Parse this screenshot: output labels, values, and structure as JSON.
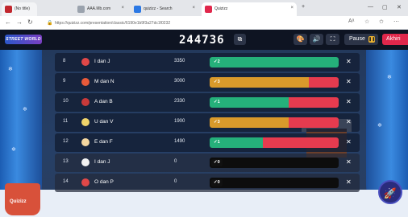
{
  "browser": {
    "tabs": [
      {
        "label": "(No title)",
        "favicon_color": "#c1272d"
      },
      {
        "label": "AAA.Mb.com",
        "favicon_color": "#9aa2ad"
      },
      {
        "label": "quizizz - Search",
        "favicon_color": "#2b78e4"
      },
      {
        "label": "Quizizz",
        "favicon_color": "#e0274b"
      }
    ],
    "url": "https://quizizz.com/presentation/classic/6190e1b9f3a27dc1f0232",
    "back_icon": "back-arrow",
    "forward_icon": "forward-arrow",
    "refresh_icon": "refresh"
  },
  "header": {
    "logo_text": "STREET WORLD",
    "game_code": "244736",
    "pause_label": "Pause",
    "end_label": "Akhiri"
  },
  "leaderboard": [
    {
      "rank": "8",
      "name": "I dan J",
      "score": "3350",
      "correct": "2",
      "green": 1.0,
      "orange": 0.0,
      "red": 0.0,
      "pill": "#25b07a",
      "avatar": "#e04848",
      "dim": false
    },
    {
      "rank": "9",
      "name": "M dan N",
      "score": "3000",
      "correct": "3",
      "green": 0.0,
      "orange": 0.77,
      "red": 0.23,
      "pill": "#d99a2b",
      "avatar": "#e85a3a",
      "dim": false
    },
    {
      "rank": "10",
      "name": "A dan B",
      "score": "2330",
      "correct": "1",
      "green": 0.61,
      "orange": 0.0,
      "red": 0.39,
      "pill": "#25b07a",
      "avatar": "#c83a3a",
      "dim": false
    },
    {
      "rank": "11",
      "name": "U dan V",
      "score": "1900",
      "correct": "3",
      "green": 0.0,
      "orange": 0.61,
      "red": 0.39,
      "pill": "#d99a2b",
      "avatar": "#f0d36a",
      "dim": false
    },
    {
      "rank": "12",
      "name": "E dan F",
      "score": "1490",
      "correct": "1",
      "green": 0.41,
      "orange": 0.0,
      "red": 0.59,
      "pill": "#25b07a",
      "avatar": "#f4d7a0",
      "dim": false
    },
    {
      "rank": "13",
      "name": "I dan J",
      "score": "0",
      "correct": "0",
      "green": 0.0,
      "orange": 0.0,
      "red": 0.0,
      "pill": "#111111",
      "avatar": "#f2f2f2",
      "dim": true
    },
    {
      "rank": "14",
      "name": "O dan P",
      "score": "0",
      "correct": "0",
      "green": 0.0,
      "orange": 0.0,
      "red": 0.0,
      "pill": "#111111",
      "avatar": "#e04848",
      "dim": true
    }
  ],
  "colors": {
    "green": "#25b07a",
    "orange": "#d99a2b",
    "red": "#e63b4f",
    "accent": "#e0274b"
  },
  "footer": {
    "brand": "Quizizz"
  }
}
